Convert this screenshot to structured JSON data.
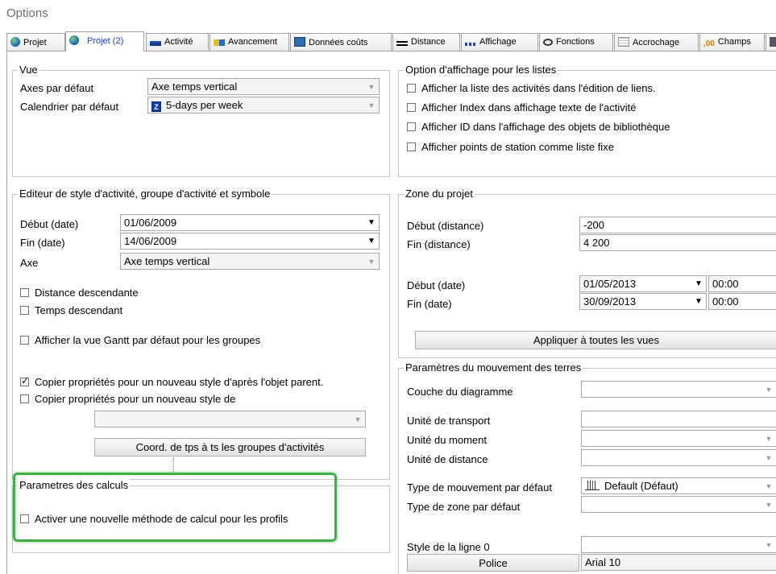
{
  "window": {
    "title": "Options"
  },
  "tabs": [
    {
      "label": "Projet",
      "icon": "globe-icon"
    },
    {
      "label": "Projet (2)",
      "icon": "globe-icon",
      "active": true
    },
    {
      "label": "Activité",
      "icon": "activity-icon"
    },
    {
      "label": "Avancement",
      "icon": "progress-icon"
    },
    {
      "label": "Données coûts",
      "icon": "cost-data-icon"
    },
    {
      "label": "Distance",
      "icon": "distance-icon"
    },
    {
      "label": "Affichage",
      "icon": "display-icon"
    },
    {
      "label": "Fonctions",
      "icon": "functions-icon"
    },
    {
      "label": "Accrochage",
      "icon": "snap-grid-icon"
    },
    {
      "label": "Champs",
      "icon": "fields-icon",
      "icon_text": ",00"
    }
  ],
  "vue": {
    "legend": "Vue",
    "axes_label": "Axes par défaut",
    "axes_value": "Axe temps vertical",
    "calendar_label": "Calendrier par défaut",
    "calendar_value": "5-days per week",
    "calendar_icon_text": "Z"
  },
  "list_display": {
    "legend": "Option d'affichage pour les listes",
    "options": [
      {
        "label": "Afficher la liste des activités dans l'édition de liens.",
        "checked": false
      },
      {
        "label": "Afficher Index dans affichage texte de l'activité",
        "checked": false
      },
      {
        "label": "Afficher ID dans l'affichage des objets de bibliothèque",
        "checked": false
      },
      {
        "label": "Afficher points de station comme liste fixe",
        "checked": false
      }
    ]
  },
  "style_editor": {
    "legend": "Editeur de style d'activité, groupe d'activité et symbole",
    "start_label": "Début (date)",
    "start_value": "01/06/2009",
    "end_label": "Fin (date)",
    "end_value": "14/06/2009",
    "axis_label": "Axe",
    "axis_value": "Axe temps vertical",
    "distance_desc": "Distance descendante",
    "time_desc": "Temps descendant",
    "gantt_default": "Afficher la vue Gantt par défaut pour les groupes",
    "copy_parent": "Copier propriétés pour un nouveau style d'après l'objet parent.",
    "copy_parent_checked": true,
    "copy_from": "Copier propriétés pour un nouveau style de",
    "coord_button": "Coord. de tps à ts les groupes d'activités"
  },
  "calc": {
    "legend": "Parametres des calculs",
    "new_method": "Activer une nouvelle méthode de calcul pour les profils"
  },
  "project_zone": {
    "legend": "Zone du projet",
    "start_dist_label": "Début (distance)",
    "start_dist_value": "-200",
    "end_dist_label": "Fin (distance)",
    "end_dist_value": "4 200",
    "start_date_label": "Début (date)",
    "start_date_value": "01/05/2013",
    "start_time_value": "00:00",
    "end_date_label": "Fin (date)",
    "end_date_value": "30/09/2013",
    "end_time_value": "00:00",
    "apply_button": "Appliquer à toutes les vues"
  },
  "earthworks": {
    "legend": "Paramètres du  mouvement des terres",
    "layer_label": "Couche du diagramme",
    "transport_label": "Unité de transport",
    "moment_label": "Unité du moment",
    "distance_label": "Unité de distance",
    "move_type_label": "Type de mouvement par défaut",
    "move_type_value": "Default (Défaut)",
    "zone_type_label": "Type de zone par défaut",
    "line_style_label": "Style de la ligne 0",
    "font_button": "Police",
    "font_value": "Arial 10"
  },
  "colors": {
    "highlight": "#3cb043",
    "active_tab_text": "#1a3fb3"
  }
}
